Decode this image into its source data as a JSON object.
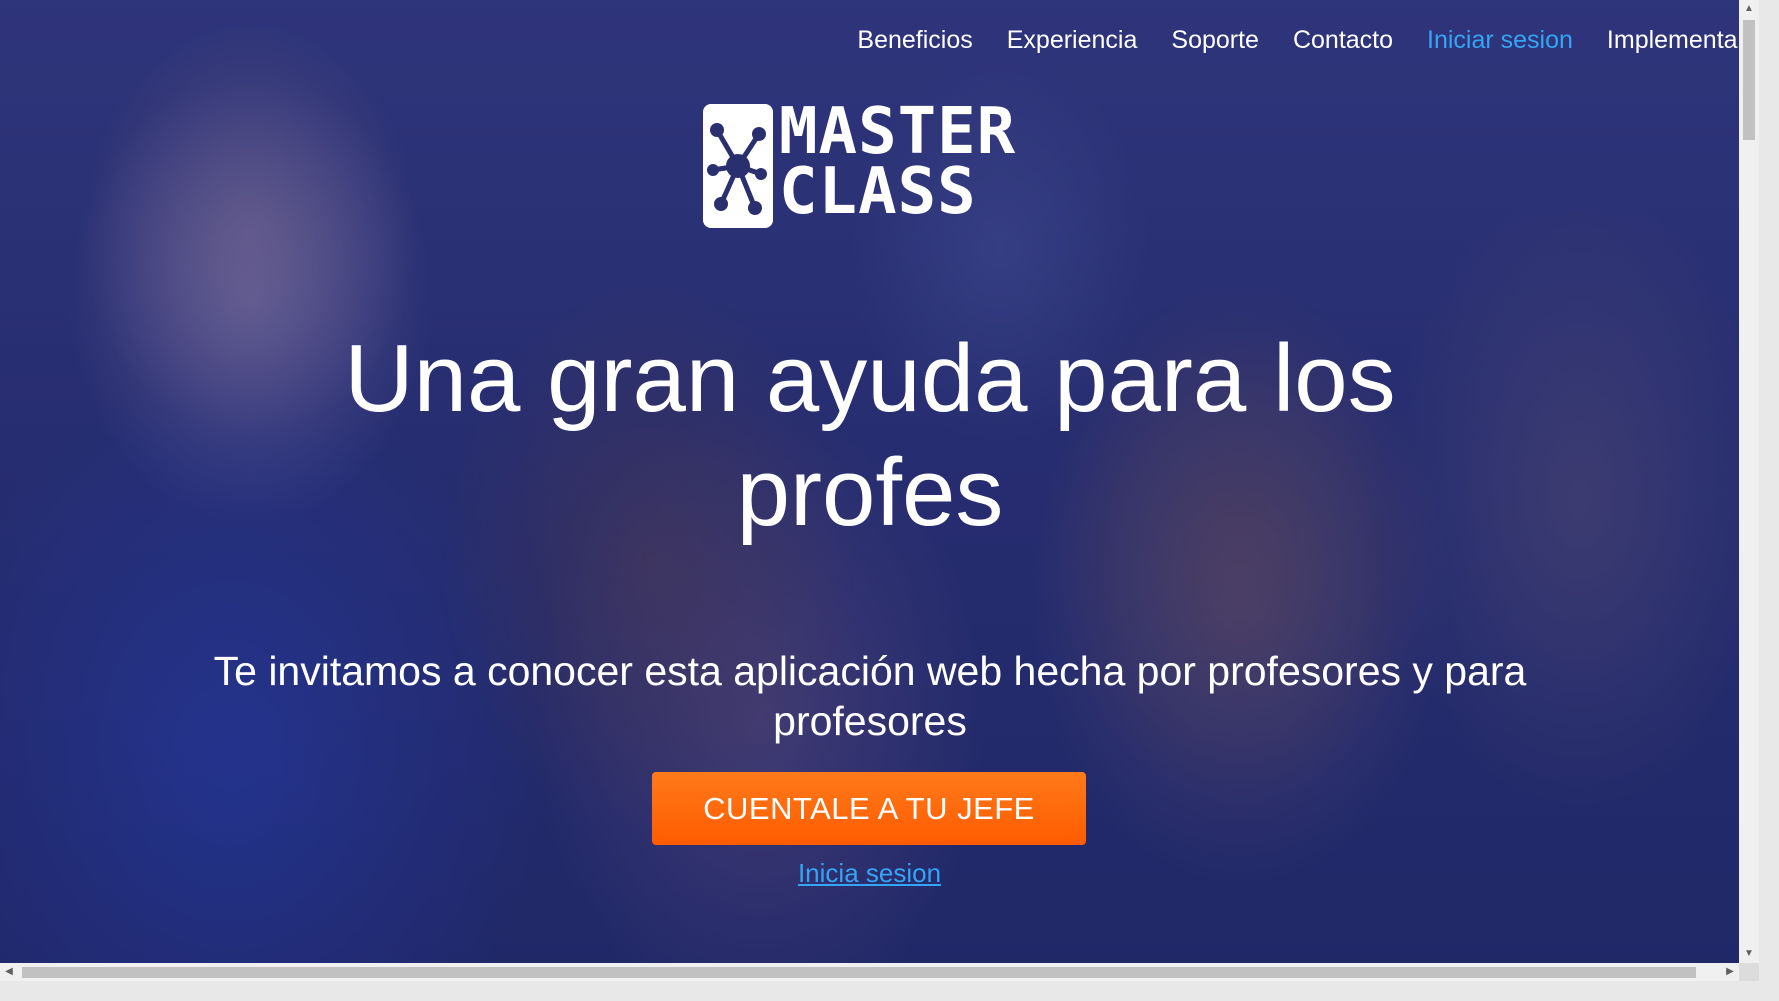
{
  "nav": {
    "items": [
      {
        "label": "Beneficios",
        "active": false
      },
      {
        "label": "Experiencia",
        "active": false
      },
      {
        "label": "Soporte",
        "active": false
      },
      {
        "label": "Contacto",
        "active": false
      },
      {
        "label": "Iniciar sesion",
        "active": true
      },
      {
        "label": "Implementalo",
        "active": false
      }
    ]
  },
  "logo": {
    "line1": "MASTER",
    "line2": "CLASS"
  },
  "hero": {
    "headline": "Una gran ayuda para los profes",
    "subtitle": "Te invitamos a conocer esta aplicación web hecha por profesores y para profesores",
    "cta_label": "CUENTALE A TU JEFE",
    "login_link": "Inicia sesion"
  },
  "icons": {
    "logo_mark": "network-molecule-icon",
    "scroll_up": "scroll-up-arrow-icon",
    "scroll_down": "scroll-down-arrow-icon",
    "scroll_left": "scroll-left-arrow-icon",
    "scroll_right": "scroll-right-arrow-icon"
  },
  "colors": {
    "link_active": "#35a4f4",
    "cta_background": "#ff6a0a",
    "hero_overlay": "#2c3272"
  }
}
